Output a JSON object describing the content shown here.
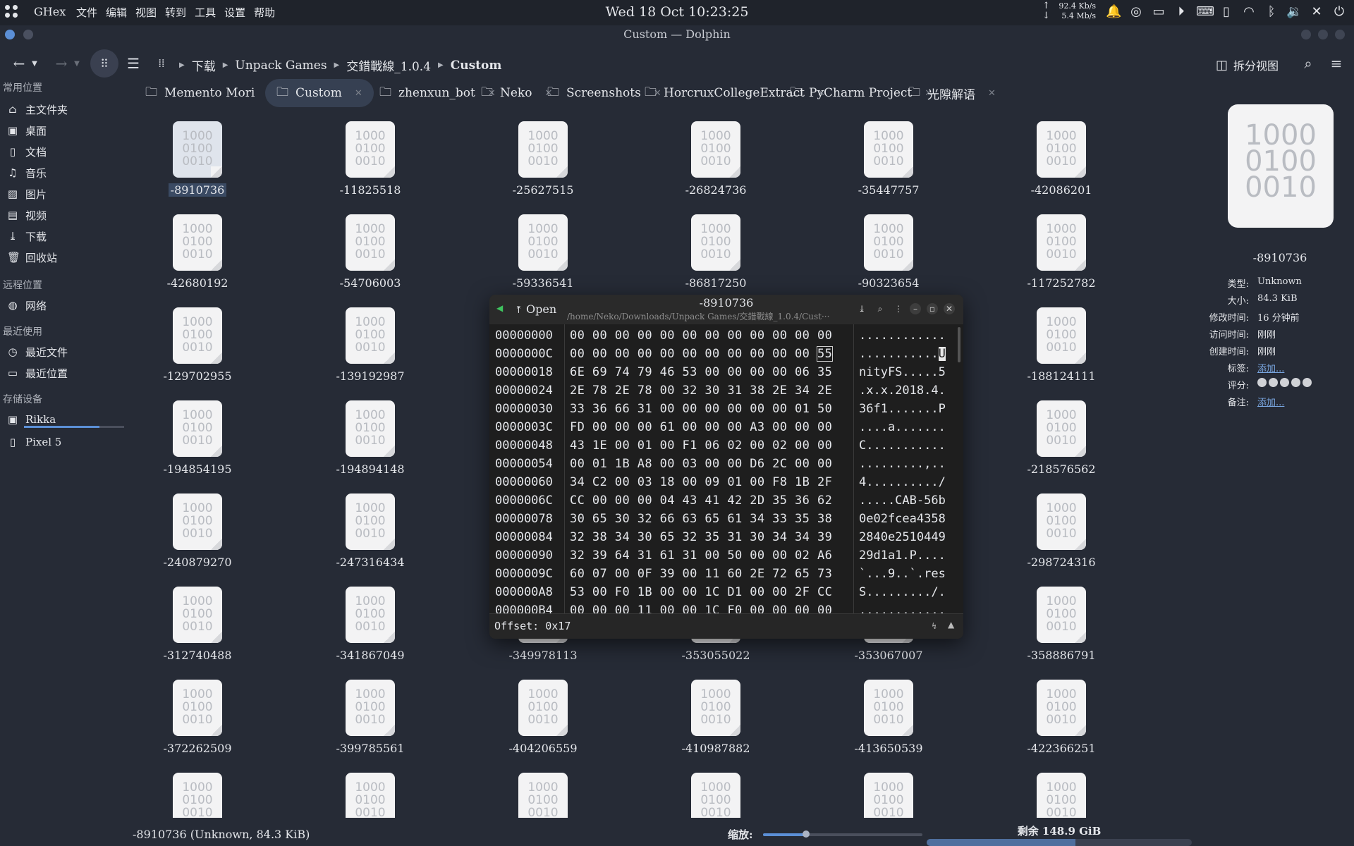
{
  "topbar": {
    "app_name": "GHex",
    "menus": [
      "文件",
      "编辑",
      "视图",
      "转到",
      "工具",
      "设置",
      "帮助"
    ],
    "clock": "Wed 18 Oct  10:23:25",
    "net_up": "92.4 Kb/s",
    "net_down": "5.4 Mb/s"
  },
  "window": {
    "title": "Custom — Dolphin"
  },
  "toolbar": {
    "breadcrumb": [
      "下载",
      "Unpack Games",
      "交錯戰線_1.0.4",
      "Custom"
    ],
    "split_label": "拆分视图"
  },
  "sidebar": {
    "places_header": "常用位置",
    "places": [
      {
        "label": "主文件夹",
        "icon": "home-icon"
      },
      {
        "label": "桌面",
        "icon": "desktop-icon"
      },
      {
        "label": "文档",
        "icon": "document-icon"
      },
      {
        "label": "音乐",
        "icon": "music-icon"
      },
      {
        "label": "图片",
        "icon": "picture-icon"
      },
      {
        "label": "视频",
        "icon": "video-icon"
      },
      {
        "label": "下载",
        "icon": "download-icon"
      },
      {
        "label": "回收站",
        "icon": "trash-icon"
      }
    ],
    "remote_header": "远程位置",
    "remote": [
      {
        "label": "网络",
        "icon": "network-icon"
      }
    ],
    "recent_header": "最近使用",
    "recent": [
      {
        "label": "最近文件",
        "icon": "recent-files-icon"
      },
      {
        "label": "最近位置",
        "icon": "recent-locations-icon"
      }
    ],
    "devices_header": "存储设备",
    "devices": [
      {
        "label": "Rikka",
        "icon": "drive-icon",
        "usage": 0.75
      },
      {
        "label": "Pixel 5",
        "icon": "phone-icon"
      }
    ]
  },
  "tabs": [
    {
      "label": "Memento Mori",
      "active": false
    },
    {
      "label": "Custom",
      "active": true
    },
    {
      "label": "zhenxun_bot",
      "active": false
    },
    {
      "label": "Neko",
      "active": false
    },
    {
      "label": "Screenshots",
      "active": false
    },
    {
      "label": "HorcruxCollegeExtract",
      "active": false
    },
    {
      "label": "PyCharm Project",
      "active": false
    },
    {
      "label": "光隙解语",
      "active": false
    }
  ],
  "file_icon_text": [
    "1000",
    "0100",
    "0010"
  ],
  "files": [
    "-8910736",
    "-11825518",
    "-25627515",
    "-26824736",
    "-35447757",
    "-42086201",
    "-42680192",
    "-54706003",
    "-59336541",
    "-86817250",
    "-90323654",
    "-117252782",
    "-129702955",
    "-139192987",
    "",
    "",
    "",
    "-188124111",
    "-194854195",
    "-194894148",
    "",
    "",
    "",
    "-218576562",
    "-240879270",
    "-247316434",
    "",
    "",
    "",
    "-298724316",
    "-312740488",
    "-341867049",
    "-349978113",
    "-353055022",
    "-353067007",
    "-358886791",
    "-372262509",
    "-399785561",
    "-404206559",
    "-410987882",
    "-413650539",
    "-422366251",
    "",
    "",
    "",
    "",
    "",
    ""
  ],
  "info": {
    "name": "-8910736",
    "rows": [
      {
        "key": "类型:",
        "value": "Unknown"
      },
      {
        "key": "大小:",
        "value": "84.3 KiB"
      },
      {
        "key": "修改时间:",
        "value": "16 分钟前"
      },
      {
        "key": "访问时间:",
        "value": "刚刚"
      },
      {
        "key": "创建时间:",
        "value": "刚刚"
      },
      {
        "key": "标签:",
        "value": "添加...",
        "link": true
      },
      {
        "key": "评分:",
        "value": "",
        "stars": 5
      },
      {
        "key": "备注:",
        "value": "添加...",
        "link": true
      }
    ]
  },
  "status": {
    "selection": "-8910736 (Unknown, 84.3 KiB)",
    "zoom_label": "缩放:",
    "zoom_level": 0.27,
    "free_space": "剩余 148.9 GiB",
    "space_used": 0.56
  },
  "ghex": {
    "open_label": "Open",
    "title": "-8910736",
    "path": "/home/Neko/Downloads/Unpack Games/交錯戰線_1.0.4/Cust···",
    "offset": "Offset: 0x17",
    "rows": [
      {
        "off": "00000000",
        "hex": "00 00 00 00 00 00 00 00 00 00 00 00",
        "asc": "............"
      },
      {
        "off": "0000000C",
        "hex": "00 00 00 00 00 00 00 00 00 00 00 55",
        "asc": "...........U"
      },
      {
        "off": "00000018",
        "hex": "6E 69 74 79 46 53 00 00 00 00 06 35",
        "asc": "nityFS.....5"
      },
      {
        "off": "00000024",
        "hex": "2E 78 2E 78 00 32 30 31 38 2E 34 2E",
        "asc": ".x.x.2018.4."
      },
      {
        "off": "00000030",
        "hex": "33 36 66 31 00 00 00 00 00 00 01 50",
        "asc": "36f1.......P"
      },
      {
        "off": "0000003C",
        "hex": "FD 00 00 00 61 00 00 00 A3 00 00 00",
        "asc": "....a......."
      },
      {
        "off": "00000048",
        "hex": "43 1E 00 01 00 F1 06 02 00 02 00 00",
        "asc": "C..........."
      },
      {
        "off": "00000054",
        "hex": "00 01 1B A8 00 03 00 00 D6 2C 00 00",
        "asc": ".........,.."
      },
      {
        "off": "00000060",
        "hex": "34 C2 00 03 18 00 09 01 00 F8 1B 2F",
        "asc": "4........../"
      },
      {
        "off": "0000006C",
        "hex": "CC 00 00 00 04 43 41 42 2D 35 36 62",
        "asc": ".....CAB-56b"
      },
      {
        "off": "00000078",
        "hex": "30 65 30 32 66 63 65 61 34 33 35 38",
        "asc": "0e02fcea4358"
      },
      {
        "off": "00000084",
        "hex": "32 38 34 30 65 32 35 31 30 34 34 39",
        "asc": "2840e2510449"
      },
      {
        "off": "00000090",
        "hex": "32 39 64 31 61 31 00 50 00 00 02 A6",
        "asc": "29d1a1.P...."
      },
      {
        "off": "0000009C",
        "hex": "60 07 00 0F 39 00 11 60 2E 72 65 73",
        "asc": "`...9..`.res"
      },
      {
        "off": "000000A8",
        "hex": "53 00 F0 1B 00 00 1C D1 00 00 2F CC",
        "asc": "S........./."
      },
      {
        "off": "000000B4",
        "hex": "00 00 00 11 00 00 1C F0 00 00 00 00",
        "asc": "............"
      }
    ]
  }
}
